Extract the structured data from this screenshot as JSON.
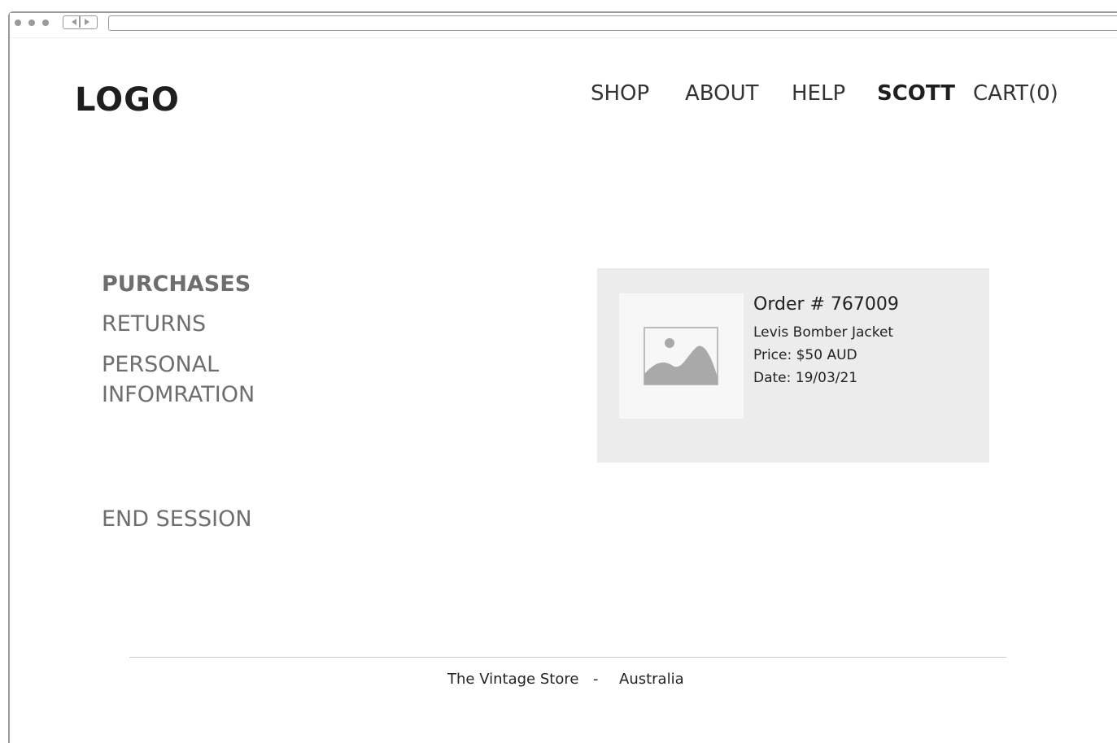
{
  "header": {
    "logo_text": "LOGO",
    "nav": [
      {
        "label": "SHOP"
      },
      {
        "label": "ABOUT"
      },
      {
        "label": "HELP"
      },
      {
        "label": "SCOTT"
      },
      {
        "label": "CART(0)"
      }
    ]
  },
  "sidebar": {
    "items": [
      {
        "label": "PURCHASES"
      },
      {
        "label": "RETURNS"
      },
      {
        "label": "PERSONAL INFOMRATION"
      },
      {
        "label": "END SESSION"
      }
    ],
    "personal_line1": "PERSONAL",
    "personal_line2": "INFOMRATION"
  },
  "order": {
    "title": "Order # 767009",
    "item": "Levis Bomber Jacket",
    "price": "Price: $50 AUD",
    "date": "Date: 19/03/21",
    "image_icon": "image-placeholder-icon"
  },
  "footer": {
    "store": "The Vintage Store",
    "separator": "-",
    "country": "Australia"
  },
  "colors": {
    "card_bg": "#ececec",
    "thumb_bg": "#f7f7f7",
    "icon_gray": "#a9a9a9",
    "sidebar_text": "#6e6e6e"
  }
}
